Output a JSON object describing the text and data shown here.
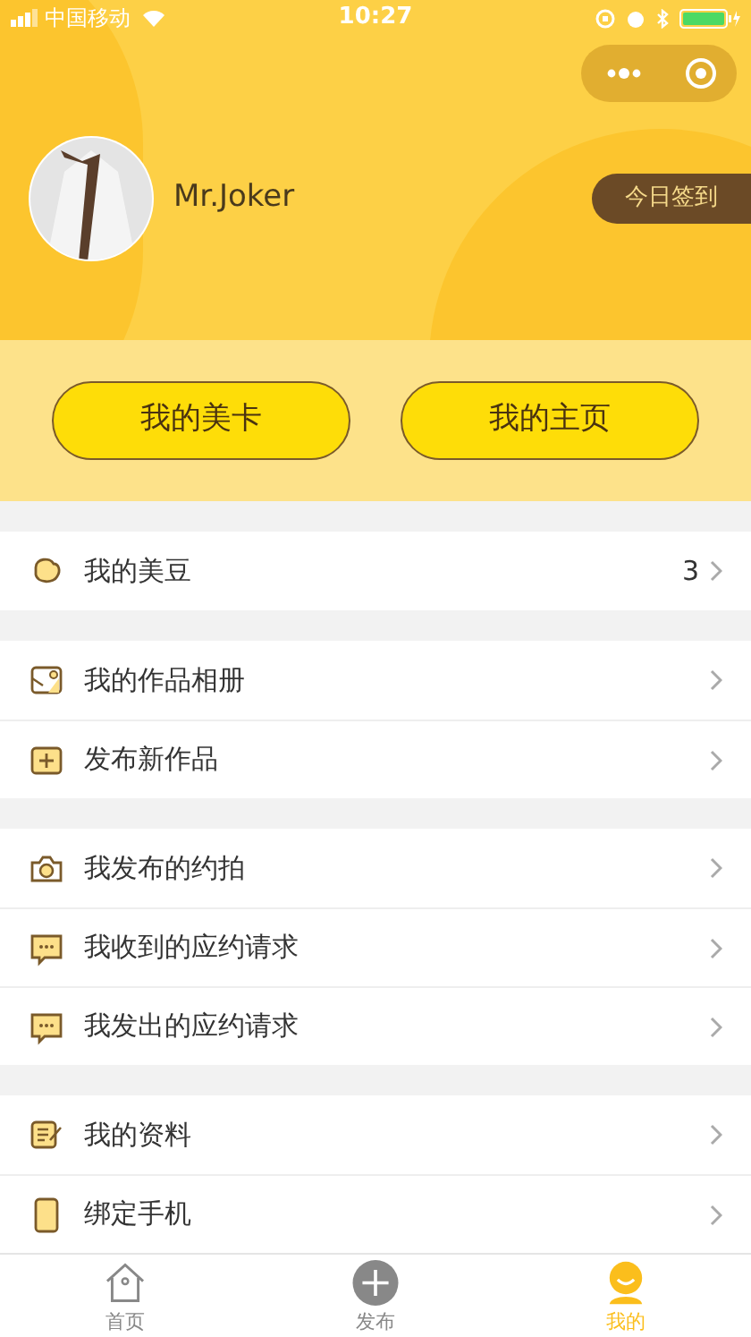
{
  "status_bar": {
    "carrier": "中国移动",
    "time": "10:27"
  },
  "profile": {
    "name": "Mr.Joker",
    "checkin_button": "今日签到"
  },
  "cards": [
    "我的美卡",
    "我的主页"
  ],
  "sections": [
    [
      {
        "label": "我的美豆",
        "value": "3"
      }
    ],
    [
      {
        "label": "我的作品相册"
      },
      {
        "label": "发布新作品"
      }
    ],
    [
      {
        "label": "我发布的约拍"
      },
      {
        "label": "我收到的应约请求"
      },
      {
        "label": "我发出的应约请求"
      }
    ],
    [
      {
        "label": "我的资料"
      },
      {
        "label": "绑定手机"
      }
    ]
  ],
  "tab_bar": [
    {
      "label": "首页",
      "selected": false
    },
    {
      "label": "发布",
      "selected": false
    },
    {
      "label": "我的",
      "selected": true
    }
  ]
}
